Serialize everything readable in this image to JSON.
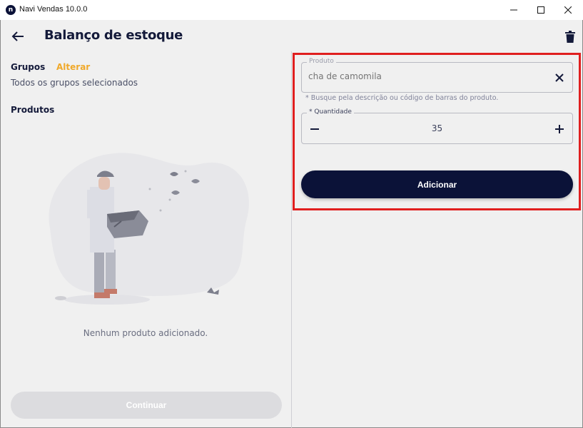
{
  "window": {
    "title": "Navi Vendas 10.0.0",
    "logo_letter": "n",
    "controls": [
      "minimize-icon",
      "maximize-icon",
      "close-icon"
    ]
  },
  "header": {
    "title": "Balanço de estoque",
    "back_icon": "arrow-left-icon",
    "action_icon": "trash-icon"
  },
  "left_panel": {
    "groups_label": "Grupos",
    "groups_change_label": "Alterar",
    "groups_description": "Todos os grupos selecionados",
    "products_label": "Produtos",
    "empty_message": "Nenhum produto adicionado.",
    "continue_label": "Continuar"
  },
  "form": {
    "product_legend": "Produto",
    "product_placeholder": "cha de camomila",
    "product_helper": "* Busque pela descrição ou código de barras do produto.",
    "quantity_legend": "* Quantidade",
    "quantity_value": "35",
    "add_label": "Adicionar"
  },
  "colors": {
    "primary": "#0b1238",
    "accent": "#f0a92a",
    "highlight": "#e01f1f",
    "disabled": "#dcdcdf"
  }
}
